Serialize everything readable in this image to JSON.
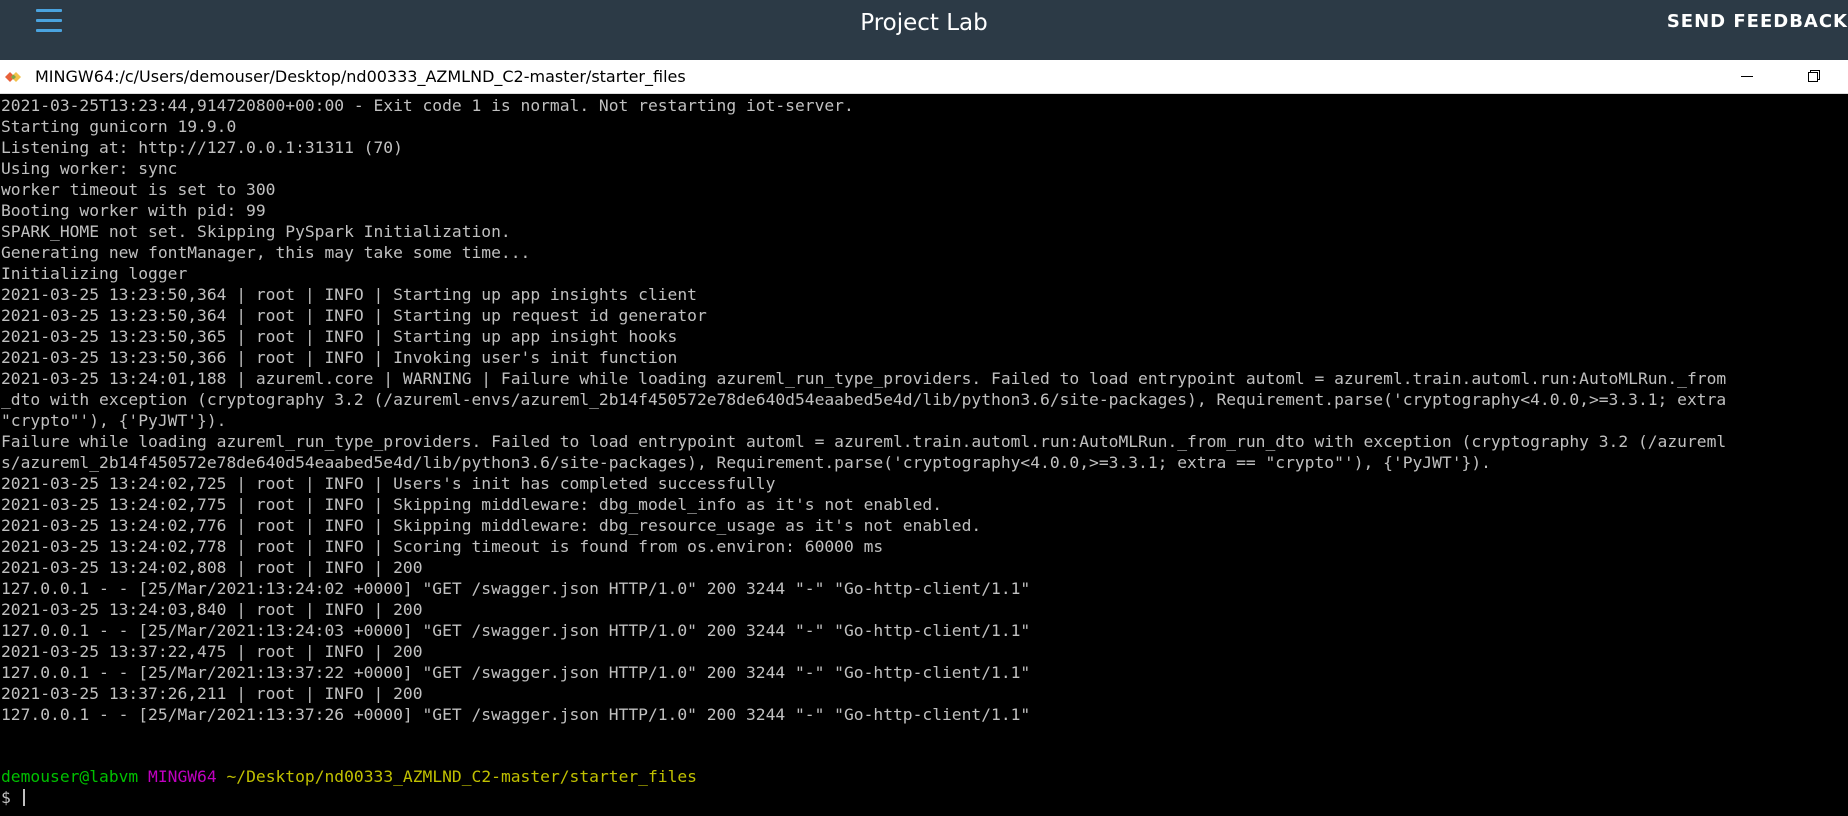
{
  "header": {
    "title": "Project Lab",
    "feedback_label": "SEND FEEDBACK",
    "accent_color": "#4aa3df",
    "background_color": "#2c3a46"
  },
  "window": {
    "title": "MINGW64:/c/Users/demouser/Desktop/nd00333_AZMLND_C2-master/starter_files",
    "icons": [
      "mintty-icon",
      "minimize-icon",
      "maximize-icon"
    ]
  },
  "terminal": {
    "lines": [
      "2021-03-25T13:23:44,914720800+00:00 - Exit code 1 is normal. Not restarting iot-server.",
      "Starting gunicorn 19.9.0",
      "Listening at: http://127.0.0.1:31311 (70)",
      "Using worker: sync",
      "worker timeout is set to 300",
      "Booting worker with pid: 99",
      "SPARK_HOME not set. Skipping PySpark Initialization.",
      "Generating new fontManager, this may take some time...",
      "Initializing logger",
      "2021-03-25 13:23:50,364 | root | INFO | Starting up app insights client",
      "2021-03-25 13:23:50,364 | root | INFO | Starting up request id generator",
      "2021-03-25 13:23:50,365 | root | INFO | Starting up app insight hooks",
      "2021-03-25 13:23:50,366 | root | INFO | Invoking user's init function",
      "2021-03-25 13:24:01,188 | azureml.core | WARNING | Failure while loading azureml_run_type_providers. Failed to load entrypoint automl = azureml.train.automl.run:AutoMLRun._from",
      "_dto with exception (cryptography 3.2 (/azureml-envs/azureml_2b14f450572e78de640d54eaabed5e4d/lib/python3.6/site-packages), Requirement.parse('cryptography<4.0.0,>=3.3.1; extra",
      "\"crypto\"'), {'PyJWT'}).",
      "Failure while loading azureml_run_type_providers. Failed to load entrypoint automl = azureml.train.automl.run:AutoMLRun._from_run_dto with exception (cryptography 3.2 (/azureml",
      "s/azureml_2b14f450572e78de640d54eaabed5e4d/lib/python3.6/site-packages), Requirement.parse('cryptography<4.0.0,>=3.3.1; extra == \"crypto\"'), {'PyJWT'}).",
      "2021-03-25 13:24:02,725 | root | INFO | Users's init has completed successfully",
      "2021-03-25 13:24:02,775 | root | INFO | Skipping middleware: dbg_model_info as it's not enabled.",
      "2021-03-25 13:24:02,776 | root | INFO | Skipping middleware: dbg_resource_usage as it's not enabled.",
      "2021-03-25 13:24:02,778 | root | INFO | Scoring timeout is found from os.environ: 60000 ms",
      "2021-03-25 13:24:02,808 | root | INFO | 200",
      "127.0.0.1 - - [25/Mar/2021:13:24:02 +0000] \"GET /swagger.json HTTP/1.0\" 200 3244 \"-\" \"Go-http-client/1.1\"",
      "2021-03-25 13:24:03,840 | root | INFO | 200",
      "127.0.0.1 - - [25/Mar/2021:13:24:03 +0000] \"GET /swagger.json HTTP/1.0\" 200 3244 \"-\" \"Go-http-client/1.1\"",
      "2021-03-25 13:37:22,475 | root | INFO | 200",
      "127.0.0.1 - - [25/Mar/2021:13:37:22 +0000] \"GET /swagger.json HTTP/1.0\" 200 3244 \"-\" \"Go-http-client/1.1\"",
      "2021-03-25 13:37:26,211 | root | INFO | 200",
      "127.0.0.1 - - [25/Mar/2021:13:37:26 +0000] \"GET /swagger.json HTTP/1.0\" 200 3244 \"-\" \"Go-http-client/1.1\""
    ],
    "prompt": {
      "user_host": "demouser@labvm",
      "shell": "MINGW64",
      "path": "~/Desktop/nd00333_AZMLND_C2-master/starter_files",
      "symbol": "$",
      "user_color": "#00c000",
      "shell_color": "#c000c0",
      "path_color": "#c0c000"
    },
    "text_color": "#c0c0c0",
    "background_color": "#000000"
  }
}
